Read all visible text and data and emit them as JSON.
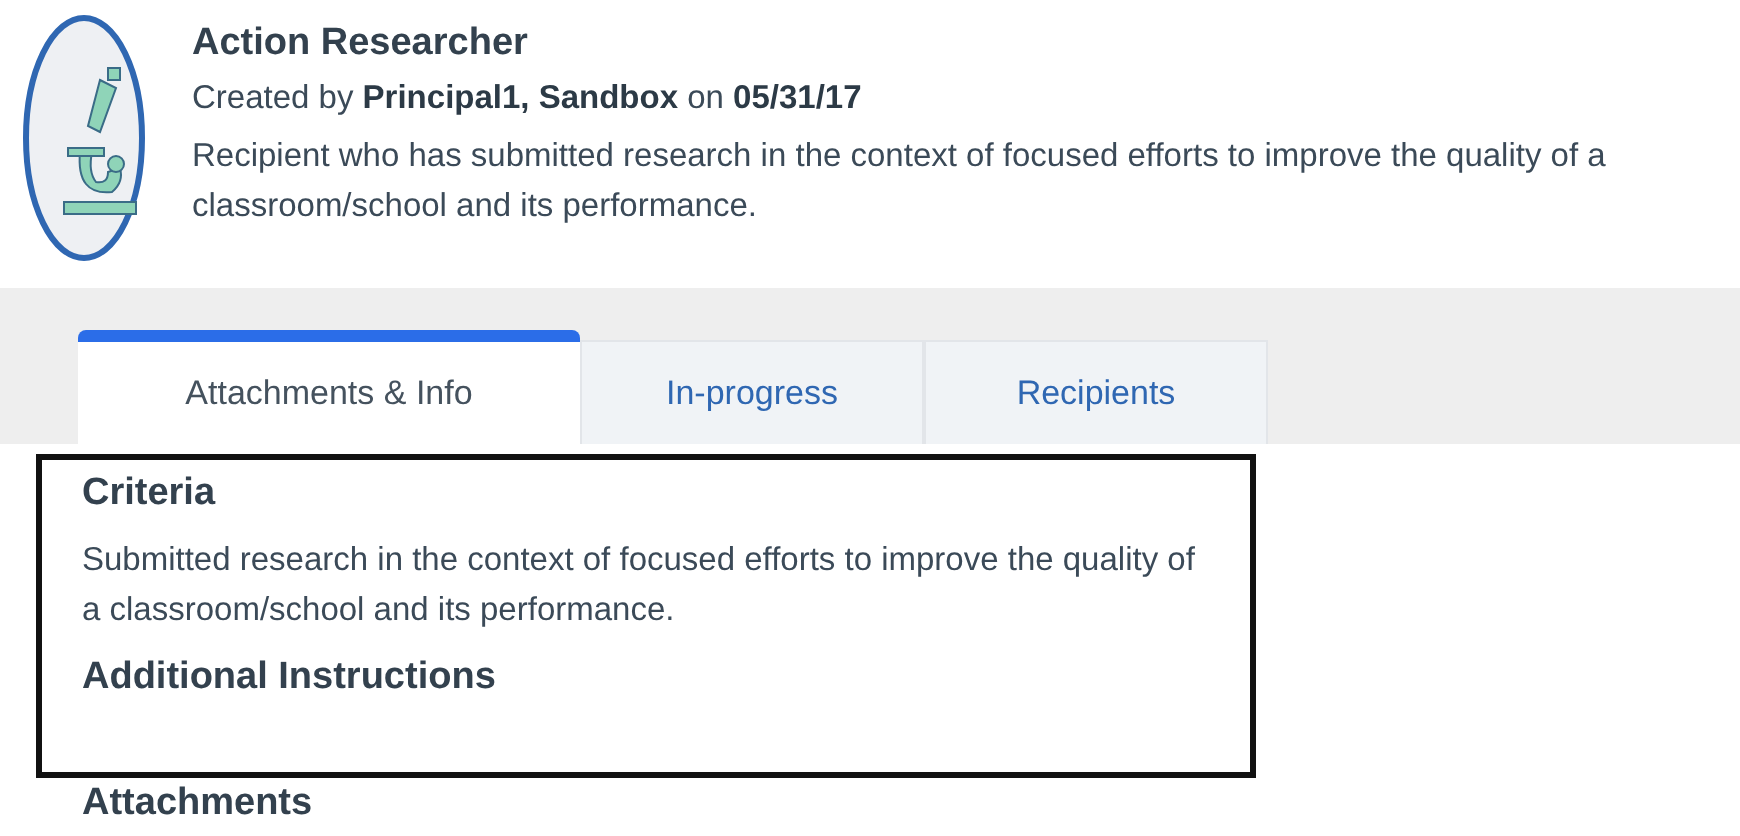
{
  "badge": {
    "title": "Action Researcher",
    "created_prefix": "Created by ",
    "creator": "Principal1, Sandbox",
    "created_mid": " on ",
    "date": "05/31/17",
    "description": "Recipient who has submitted research in the context of focused efforts to improve the quality of a classroom/school and its performance."
  },
  "tabs": [
    {
      "label": "Attachments & Info",
      "selected": true
    },
    {
      "label": "In-progress",
      "selected": false
    },
    {
      "label": "Recipients",
      "selected": false
    }
  ],
  "sections": [
    {
      "heading": "Criteria",
      "text": "Submitted research in the context of focused efforts to improve the quality of a classroom/school and its performance."
    },
    {
      "heading": "Additional Instructions"
    }
  ],
  "next_heading": "Attachments"
}
